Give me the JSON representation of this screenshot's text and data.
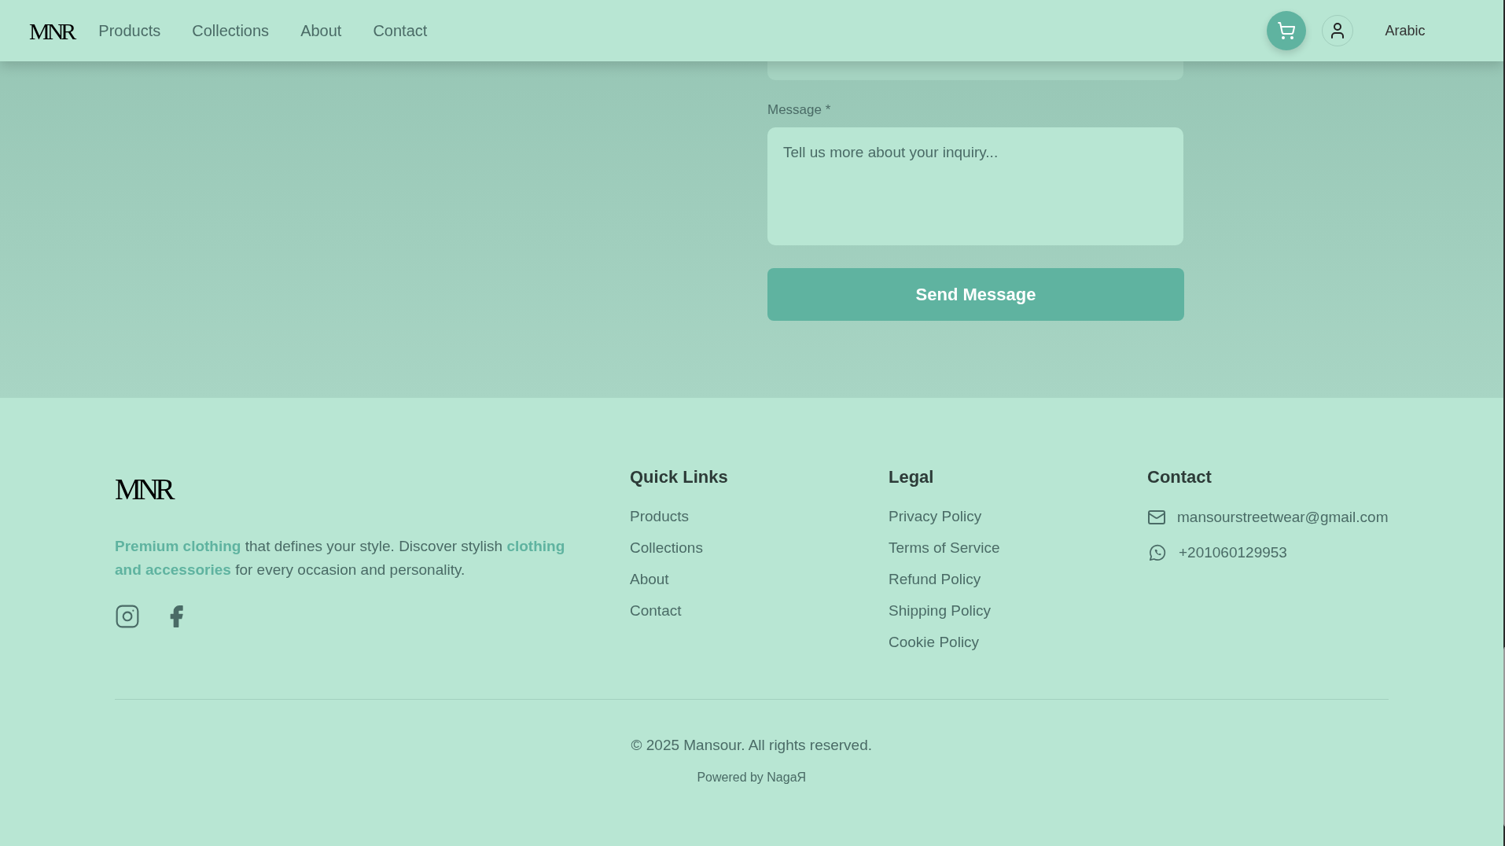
{
  "header": {
    "logo": "MNR",
    "nav": [
      "Products",
      "Collections",
      "About",
      "Contact"
    ],
    "language": "Arabic"
  },
  "form": {
    "message_label": "Message *",
    "message_placeholder": "Tell us more about your inquiry...",
    "submit": "Send Message"
  },
  "footer": {
    "logo": "MNR",
    "tagline": "**Premium clothing** that defines your style. Discover stylish **clothing and accessories** for every occasion and personality.",
    "columns": [
      {
        "title": "Quick Links",
        "links": [
          "Products",
          "Collections",
          "About",
          "Contact"
        ]
      },
      {
        "title": "Legal",
        "links": [
          "Privacy Policy",
          "Terms of Service",
          "Refund Policy",
          "Shipping Policy",
          "Cookie Policy"
        ]
      }
    ],
    "contact": {
      "title": "Contact",
      "items": [
        {
          "kind": "email",
          "text": "mansourstreetwear@gmail.com"
        },
        {
          "kind": "whatsapp",
          "text": "+201060129953"
        }
      ]
    },
    "copyright": "© 2025 Mansour. All rights reserved.",
    "powered": "Powered by NagaЯ"
  }
}
